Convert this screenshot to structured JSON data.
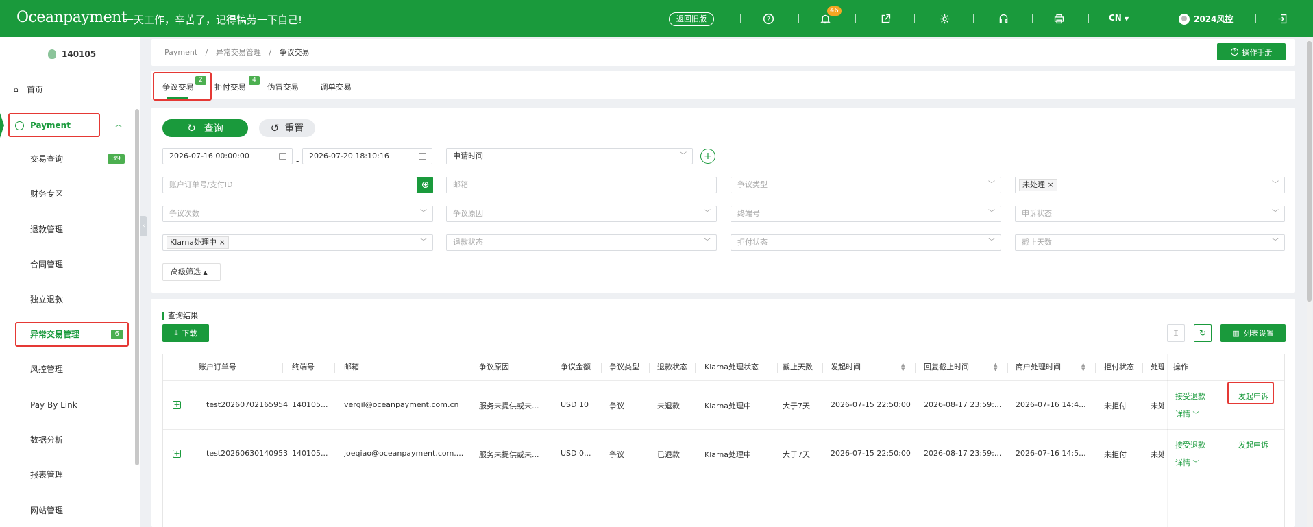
{
  "topbar": {
    "logo": "Oceanpayment",
    "slogan": "一天工作，辛苦了，记得犒劳一下自己!",
    "old_version_button": "返回旧版",
    "notification_count": "46",
    "language": "CN",
    "username": "2024风控"
  },
  "sidebar": {
    "account_id": "140105",
    "items": [
      {
        "label": "首页"
      },
      {
        "label": "Payment"
      },
      {
        "label": "交易查询",
        "count": "39"
      },
      {
        "label": "财务专区"
      },
      {
        "label": "退款管理"
      },
      {
        "label": "合同管理"
      },
      {
        "label": "独立退款"
      },
      {
        "label": "异常交易管理",
        "count": "6"
      },
      {
        "label": "风控管理"
      },
      {
        "label": "Pay By Link"
      },
      {
        "label": "数据分析"
      },
      {
        "label": "报表管理"
      },
      {
        "label": "网站管理"
      }
    ]
  },
  "breadcrumb": {
    "level1": "Payment",
    "sep": "/",
    "level2": "异常交易管理",
    "current": "争议交易"
  },
  "manual_button": "操作手册",
  "tabs": [
    {
      "label": "争议交易",
      "badge": "2",
      "active": true
    },
    {
      "label": "拒付交易",
      "badge": "4"
    },
    {
      "label": "伪冒交易"
    },
    {
      "label": "调单交易"
    }
  ],
  "filters": {
    "query_button": "查询",
    "reset_button": "重置",
    "start_date": "2026-07-16 00:00:00",
    "range_sep": "-",
    "end_date": "2026-07-20 18:10:16",
    "time_type": "申请时间",
    "order_id_placeholder": "账户订单号/支付ID",
    "email_placeholder": "邮箱",
    "dispute_type_placeholder": "争议类型",
    "process_status_tag": "未处理",
    "dispute_count_placeholder": "争议次数",
    "dispute_reason_placeholder": "争议原因",
    "terminal_placeholder": "终端号",
    "appeal_status_placeholder": "申诉状态",
    "klarna_tag": "Klarna处理中",
    "refund_status_placeholder": "退款状态",
    "chargeback_status_placeholder": "拒付状态",
    "deadline_days_placeholder": "截止天数",
    "advanced_button": "高级筛选"
  },
  "results": {
    "title": "查询结果",
    "download_button": "下载",
    "column_settings_button": "列表设置",
    "columns": [
      "账户订单号",
      "终端号",
      "邮箱",
      "争议原因",
      "争议金额",
      "争议类型",
      "退款状态",
      "Klarna处理状态",
      "截止天数",
      "发起时间",
      "回复截止时间",
      "商户处理时间",
      "拒付状态",
      "处理",
      "操作"
    ],
    "rows": [
      {
        "order_no": "test20260702165954",
        "terminal": "140105...",
        "email": "vergil@oceanpayment.com.cn",
        "reason": "服务未提供或未...",
        "amount": "USD 10",
        "type": "争议",
        "refund_status": "未退款",
        "klarna_status": "Klarna处理中",
        "deadline": "大于7天",
        "created": "2026-07-15 22:50:00",
        "reply_deadline": "2026-08-17 23:59:...",
        "merchant_time": "2026-07-16 14:4...",
        "chargeback_status": "未拒付",
        "process": "未处",
        "accept_refund": "接受退款",
        "details": "详情",
        "appeal": "发起申诉"
      },
      {
        "order_no": "test20260630140953",
        "terminal": "140105...",
        "email": "joeqiao@oceanpayment.com....",
        "reason": "服务未提供或未...",
        "amount": "USD 0...",
        "type": "争议",
        "refund_status": "已退款",
        "klarna_status": "Klarna处理中",
        "deadline": "大于7天",
        "created": "2026-07-15 22:50:00",
        "reply_deadline": "2026-08-17 23:59:...",
        "merchant_time": "2026-07-16 14:5...",
        "chargeback_status": "未拒付",
        "process": "未处",
        "accept_refund": "接受退款",
        "details": "详情",
        "appeal": "发起申诉"
      }
    ]
  },
  "colors": {
    "brand": "#1a9a3c",
    "highlight": "#e53935",
    "badge": "#f5a623"
  }
}
